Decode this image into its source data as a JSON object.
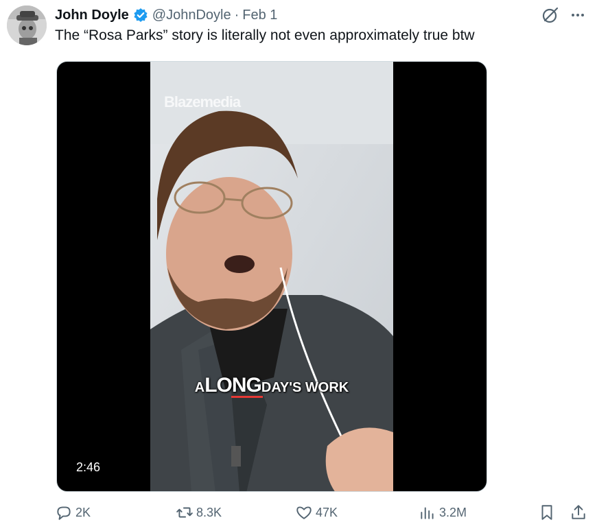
{
  "author": {
    "name": "John Doyle",
    "handle": "@JohnDoyle",
    "separator": "·",
    "date": "Feb 1"
  },
  "tweet": {
    "text": "The “Rosa Parks” story is literally not even approximately true btw"
  },
  "media": {
    "watermark": "Blazemedia",
    "caption_a": "A",
    "caption_long": "LONG",
    "caption_rest": "DAY'S WORK",
    "duration": "2:46"
  },
  "actions": {
    "replies": "2K",
    "reposts": "8.3K",
    "likes": "47K",
    "views": "3.2M"
  },
  "colors": {
    "verified": "#1d9bf0",
    "muted_text": "#536471",
    "primary_text": "#0f1419"
  }
}
